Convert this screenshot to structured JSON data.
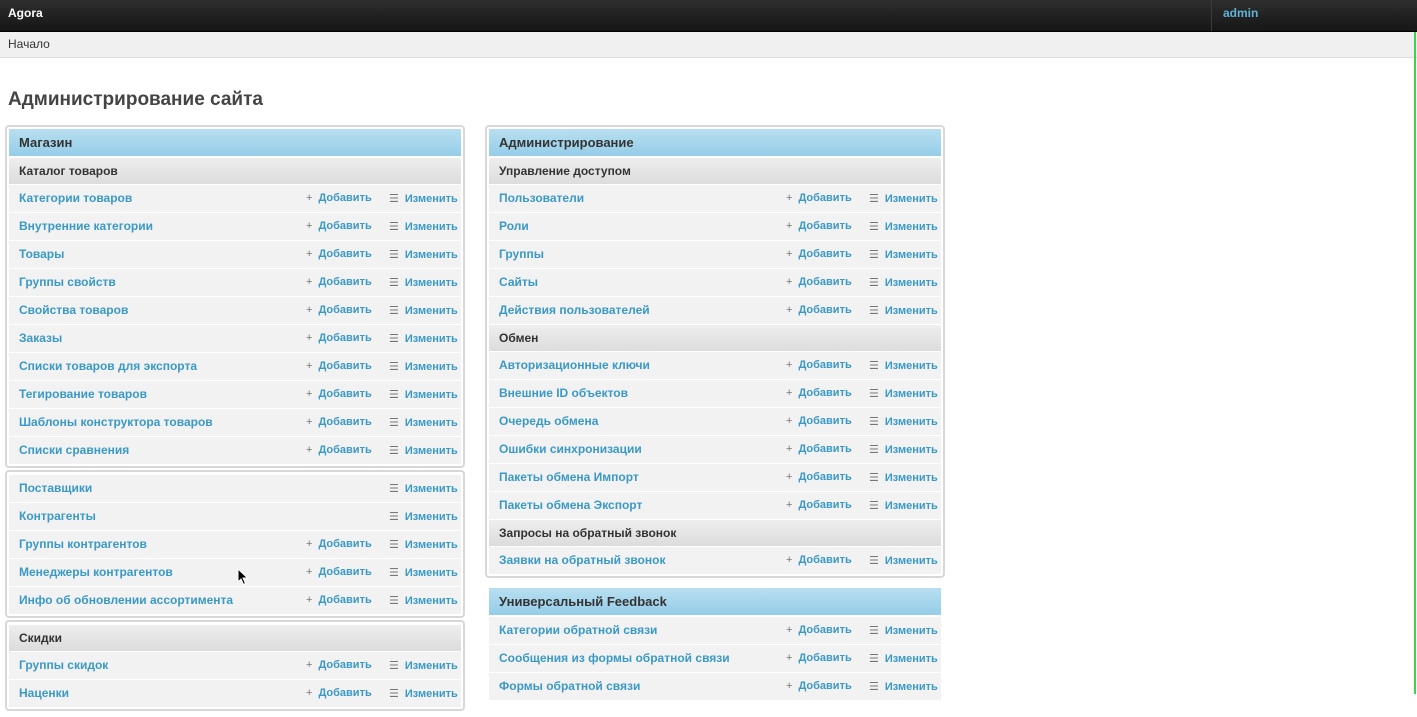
{
  "header": {
    "brand": "Agora",
    "user": "admin"
  },
  "breadcrumb": "Начало",
  "page_title": "Администрирование сайта",
  "actions": {
    "add": "Добавить",
    "change": "Изменить"
  },
  "left": {
    "shop": {
      "caption": "Магазин",
      "catalog_caption": "Каталог товаров",
      "catalog": [
        "Категории товаров",
        "Внутренние категории",
        "Товары",
        "Группы свойств",
        "Свойства товаров",
        "Заказы",
        "Списки товаров для экспорта",
        "Тегирование товаров",
        "Шаблоны конструктора товаров",
        "Списки сравнения"
      ],
      "partners": [
        "Поставщики",
        "Контрагенты",
        "Группы контрагентов",
        "Менеджеры контрагентов",
        "Инфо об обновлении ассортимента"
      ],
      "discounts_caption": "Скидки",
      "discounts": [
        "Группы скидок",
        "Наценки"
      ]
    }
  },
  "right": {
    "admin": {
      "caption": "Администрирование",
      "access_caption": "Управление доступом",
      "access": [
        "Пользователи",
        "Роли",
        "Группы",
        "Сайты",
        "Действия пользователей"
      ],
      "exchange_caption": "Обмен",
      "exchange": [
        "Авторизационные ключи",
        "Внешние ID объектов",
        "Очередь обмена",
        "Ошибки синхронизации",
        "Пакеты обмена Импорт",
        "Пакеты обмена Экспорт"
      ],
      "callback_caption": "Запросы на обратный звонок",
      "callback": [
        "Заявки на обратный звонок"
      ]
    },
    "feedback": {
      "caption": "Универсальный Feedback",
      "items": [
        "Категории обратной связи",
        "Сообщения из формы обратной связи",
        "Формы обратной связи"
      ]
    }
  }
}
